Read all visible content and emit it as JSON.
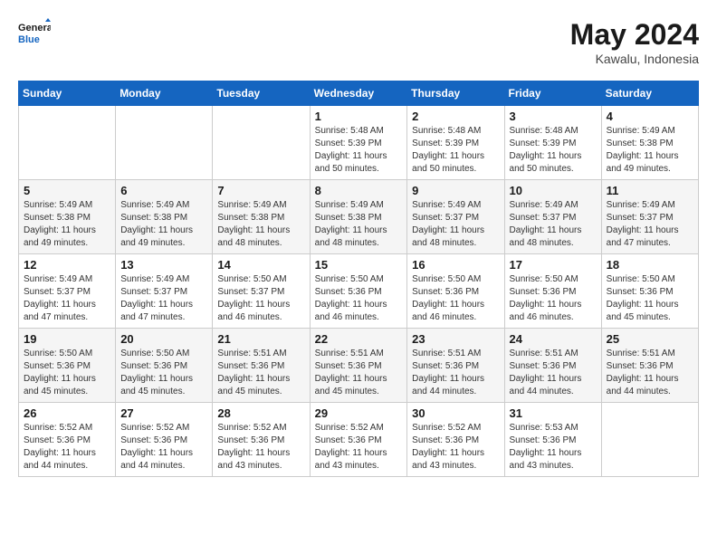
{
  "header": {
    "logo_line1": "General",
    "logo_line2": "Blue",
    "month": "May 2024",
    "location": "Kawalu, Indonesia"
  },
  "days_of_week": [
    "Sunday",
    "Monday",
    "Tuesday",
    "Wednesday",
    "Thursday",
    "Friday",
    "Saturday"
  ],
  "weeks": [
    [
      {
        "day": "",
        "info": ""
      },
      {
        "day": "",
        "info": ""
      },
      {
        "day": "",
        "info": ""
      },
      {
        "day": "1",
        "info": "Sunrise: 5:48 AM\nSunset: 5:39 PM\nDaylight: 11 hours\nand 50 minutes."
      },
      {
        "day": "2",
        "info": "Sunrise: 5:48 AM\nSunset: 5:39 PM\nDaylight: 11 hours\nand 50 minutes."
      },
      {
        "day": "3",
        "info": "Sunrise: 5:48 AM\nSunset: 5:39 PM\nDaylight: 11 hours\nand 50 minutes."
      },
      {
        "day": "4",
        "info": "Sunrise: 5:49 AM\nSunset: 5:38 PM\nDaylight: 11 hours\nand 49 minutes."
      }
    ],
    [
      {
        "day": "5",
        "info": "Sunrise: 5:49 AM\nSunset: 5:38 PM\nDaylight: 11 hours\nand 49 minutes."
      },
      {
        "day": "6",
        "info": "Sunrise: 5:49 AM\nSunset: 5:38 PM\nDaylight: 11 hours\nand 49 minutes."
      },
      {
        "day": "7",
        "info": "Sunrise: 5:49 AM\nSunset: 5:38 PM\nDaylight: 11 hours\nand 48 minutes."
      },
      {
        "day": "8",
        "info": "Sunrise: 5:49 AM\nSunset: 5:38 PM\nDaylight: 11 hours\nand 48 minutes."
      },
      {
        "day": "9",
        "info": "Sunrise: 5:49 AM\nSunset: 5:37 PM\nDaylight: 11 hours\nand 48 minutes."
      },
      {
        "day": "10",
        "info": "Sunrise: 5:49 AM\nSunset: 5:37 PM\nDaylight: 11 hours\nand 48 minutes."
      },
      {
        "day": "11",
        "info": "Sunrise: 5:49 AM\nSunset: 5:37 PM\nDaylight: 11 hours\nand 47 minutes."
      }
    ],
    [
      {
        "day": "12",
        "info": "Sunrise: 5:49 AM\nSunset: 5:37 PM\nDaylight: 11 hours\nand 47 minutes."
      },
      {
        "day": "13",
        "info": "Sunrise: 5:49 AM\nSunset: 5:37 PM\nDaylight: 11 hours\nand 47 minutes."
      },
      {
        "day": "14",
        "info": "Sunrise: 5:50 AM\nSunset: 5:37 PM\nDaylight: 11 hours\nand 46 minutes."
      },
      {
        "day": "15",
        "info": "Sunrise: 5:50 AM\nSunset: 5:36 PM\nDaylight: 11 hours\nand 46 minutes."
      },
      {
        "day": "16",
        "info": "Sunrise: 5:50 AM\nSunset: 5:36 PM\nDaylight: 11 hours\nand 46 minutes."
      },
      {
        "day": "17",
        "info": "Sunrise: 5:50 AM\nSunset: 5:36 PM\nDaylight: 11 hours\nand 46 minutes."
      },
      {
        "day": "18",
        "info": "Sunrise: 5:50 AM\nSunset: 5:36 PM\nDaylight: 11 hours\nand 45 minutes."
      }
    ],
    [
      {
        "day": "19",
        "info": "Sunrise: 5:50 AM\nSunset: 5:36 PM\nDaylight: 11 hours\nand 45 minutes."
      },
      {
        "day": "20",
        "info": "Sunrise: 5:50 AM\nSunset: 5:36 PM\nDaylight: 11 hours\nand 45 minutes."
      },
      {
        "day": "21",
        "info": "Sunrise: 5:51 AM\nSunset: 5:36 PM\nDaylight: 11 hours\nand 45 minutes."
      },
      {
        "day": "22",
        "info": "Sunrise: 5:51 AM\nSunset: 5:36 PM\nDaylight: 11 hours\nand 45 minutes."
      },
      {
        "day": "23",
        "info": "Sunrise: 5:51 AM\nSunset: 5:36 PM\nDaylight: 11 hours\nand 44 minutes."
      },
      {
        "day": "24",
        "info": "Sunrise: 5:51 AM\nSunset: 5:36 PM\nDaylight: 11 hours\nand 44 minutes."
      },
      {
        "day": "25",
        "info": "Sunrise: 5:51 AM\nSunset: 5:36 PM\nDaylight: 11 hours\nand 44 minutes."
      }
    ],
    [
      {
        "day": "26",
        "info": "Sunrise: 5:52 AM\nSunset: 5:36 PM\nDaylight: 11 hours\nand 44 minutes."
      },
      {
        "day": "27",
        "info": "Sunrise: 5:52 AM\nSunset: 5:36 PM\nDaylight: 11 hours\nand 44 minutes."
      },
      {
        "day": "28",
        "info": "Sunrise: 5:52 AM\nSunset: 5:36 PM\nDaylight: 11 hours\nand 43 minutes."
      },
      {
        "day": "29",
        "info": "Sunrise: 5:52 AM\nSunset: 5:36 PM\nDaylight: 11 hours\nand 43 minutes."
      },
      {
        "day": "30",
        "info": "Sunrise: 5:52 AM\nSunset: 5:36 PM\nDaylight: 11 hours\nand 43 minutes."
      },
      {
        "day": "31",
        "info": "Sunrise: 5:53 AM\nSunset: 5:36 PM\nDaylight: 11 hours\nand 43 minutes."
      },
      {
        "day": "",
        "info": ""
      }
    ]
  ]
}
